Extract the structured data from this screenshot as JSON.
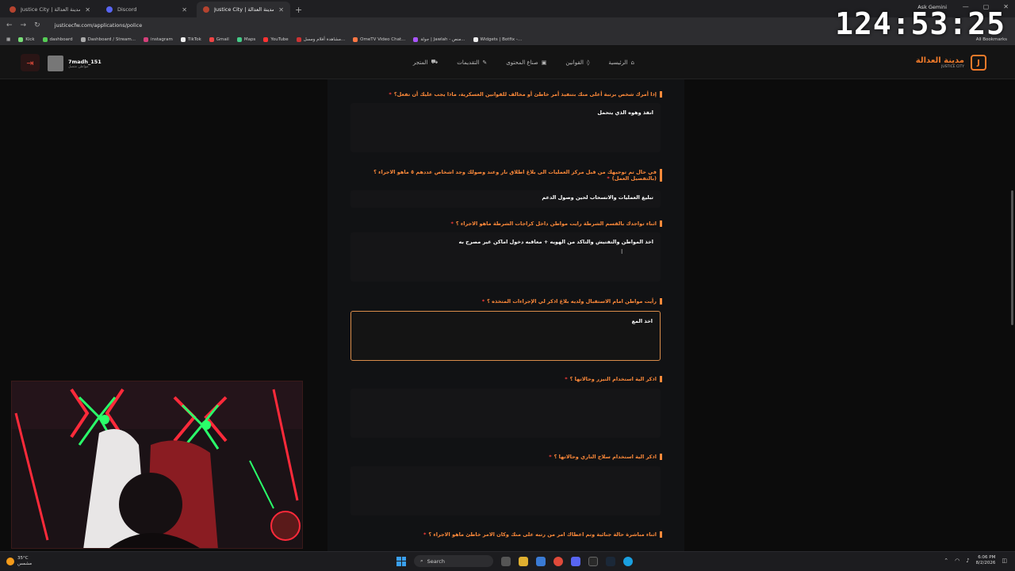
{
  "browser": {
    "tabs": [
      {
        "label": "Justice City | مدينة العدالة",
        "active": false
      },
      {
        "label": "Discord",
        "active": false
      },
      {
        "label": "Justice City | مدينة العدالة",
        "active": true
      }
    ],
    "new_tab": "+",
    "ask_gemini": "Ask Gemini",
    "url": "justicecfw.com/applications/police",
    "bookmarks": [
      "Kick",
      "dashboard",
      "Dashboard / Stream...",
      "instagram",
      "TikTok",
      "Gmail",
      "Maps",
      "YouTube",
      "مشاهدة أفلام ومسل...",
      "OmeTV Video Chat...",
      "جولة | Jawlah - منص...",
      "Widgets | Botfix -..."
    ],
    "all_bookmarks": "All Bookmarks"
  },
  "overlay_timer": "124:53:25",
  "site": {
    "user_name": "7madh_151",
    "user_role": "مواطن متصل",
    "nav": [
      "الرئيسية",
      "القوانين",
      "صناع المحتوى",
      "التقديمات",
      "المتجر"
    ],
    "brand_ar": "مدينة العدالة",
    "brand_en": "JUSTICE CITY"
  },
  "form": {
    "questions": [
      {
        "q": "إذا أمرك شخص برتبة أعلى منك بتنفيذ أمر خاطئ أو مخالف للقوانين العسكرية، ماذا يجب عليك أن تفعل؟",
        "a": "انفذ وهوه الذي يتحمل"
      },
      {
        "q": "في حال تم توجيهك من قبل مركز العمليات الى بلاغ اطلاق نار وعند وصولك وجد اشخاص عددهم ٥ ماهو الاجراء ؟ (بالتفصيل العمل)",
        "a": "تبليغ العمليات والانسحاب لحين وصول الدعم"
      },
      {
        "q": "اثناء تواجدك بالقسم الشرطة رايت مواطن داخل كراجات الشرطة ماهو الاجراء ؟",
        "a": "اخذ المواطن والتفتيش والتاكد من الهويه + معاقبه دخول اماكن غير مصرح به"
      },
      {
        "q": "رأيت مواطن امام الاستقبال ولديه بلاغ اذكر لي الإجراءات المتخذه ؟",
        "a": "اخذ المع"
      },
      {
        "q": "اذكر الية استخدام التيزر وحالاتها ؟",
        "a": ""
      },
      {
        "q": "اذكر الية استخدام سلاح الناري وحالاتها ؟",
        "a": ""
      },
      {
        "q": "اثناء مباشرة حالة جنائية وتم اعطاك امر من رتبه على منك وكان الامر خاطئ ماهو الاجراء ؟",
        "a": ""
      }
    ],
    "required_mark": "*"
  },
  "taskbar": {
    "temp": "35°C",
    "weather": "مشمس",
    "search": "Search",
    "time": "6:06 PM",
    "date": "8/2/2026"
  }
}
